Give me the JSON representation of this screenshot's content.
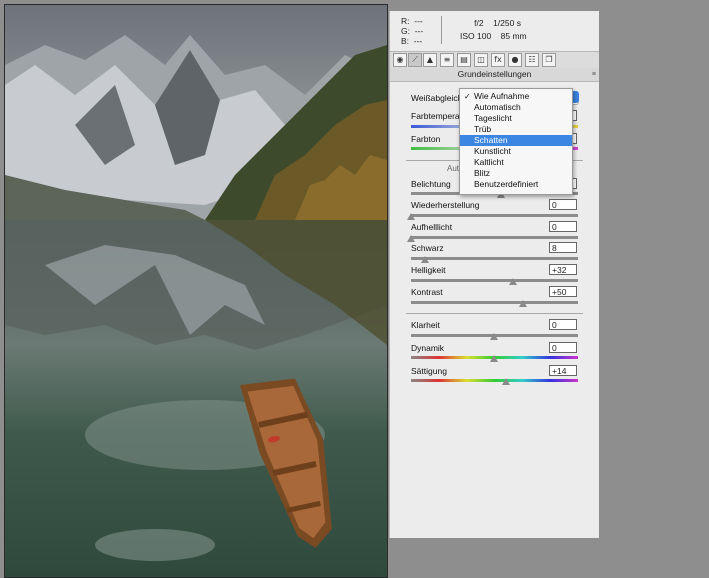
{
  "info": {
    "r_label": "R:",
    "r_value": "---",
    "g_label": "G:",
    "g_value": "---",
    "b_label": "B:",
    "b_value": "---",
    "aperture": "f/2",
    "shutter": "1/250 s",
    "iso": "ISO 100",
    "focal": "85 mm"
  },
  "toolbar": {
    "icons": [
      "histogram-icon",
      "tone-curve-icon",
      "detail-icon",
      "hsl-icon",
      "split-toning-icon",
      "lens-corrections-icon",
      "effects-icon",
      "camera-calibration-icon",
      "presets-icon",
      "snapshots-icon"
    ],
    "fx_glyph": "fx"
  },
  "panel_title": "Grundeinstellungen",
  "controls": {
    "wb_label": "Weißabgleich:",
    "temp_label": "Farbtemperatur",
    "tint_label": "Farbton",
    "auto_label": "Auto",
    "exposure": {
      "label": "Belichtung",
      "value": "0"
    },
    "recovery": {
      "label": "Wiederherstellung",
      "value": "0"
    },
    "fill_light": {
      "label": "Aufhelllicht",
      "value": "0"
    },
    "blacks": {
      "label": "Schwarz",
      "value": "8"
    },
    "brightness": {
      "label": "Helligkeit",
      "value": "+32"
    },
    "contrast": {
      "label": "Kontrast",
      "value": "+50"
    },
    "clarity": {
      "label": "Klarheit",
      "value": "0"
    },
    "vibrance": {
      "label": "Dynamik",
      "value": "0"
    },
    "saturation": {
      "label": "Sättigung",
      "value": "+14"
    }
  },
  "wb_dropdown": {
    "options": [
      "Wie Aufnahme",
      "Automatisch",
      "Tageslicht",
      "Trüb",
      "Schatten",
      "Kunstlicht",
      "Kaltlicht",
      "Blitz",
      "Benutzerdefiniert"
    ],
    "checked": "Wie Aufnahme",
    "highlighted": "Schatten"
  },
  "colors": {
    "highlight": "#3a86e0",
    "panel_bg": "#ececec",
    "app_bg": "#8e8e8e"
  }
}
